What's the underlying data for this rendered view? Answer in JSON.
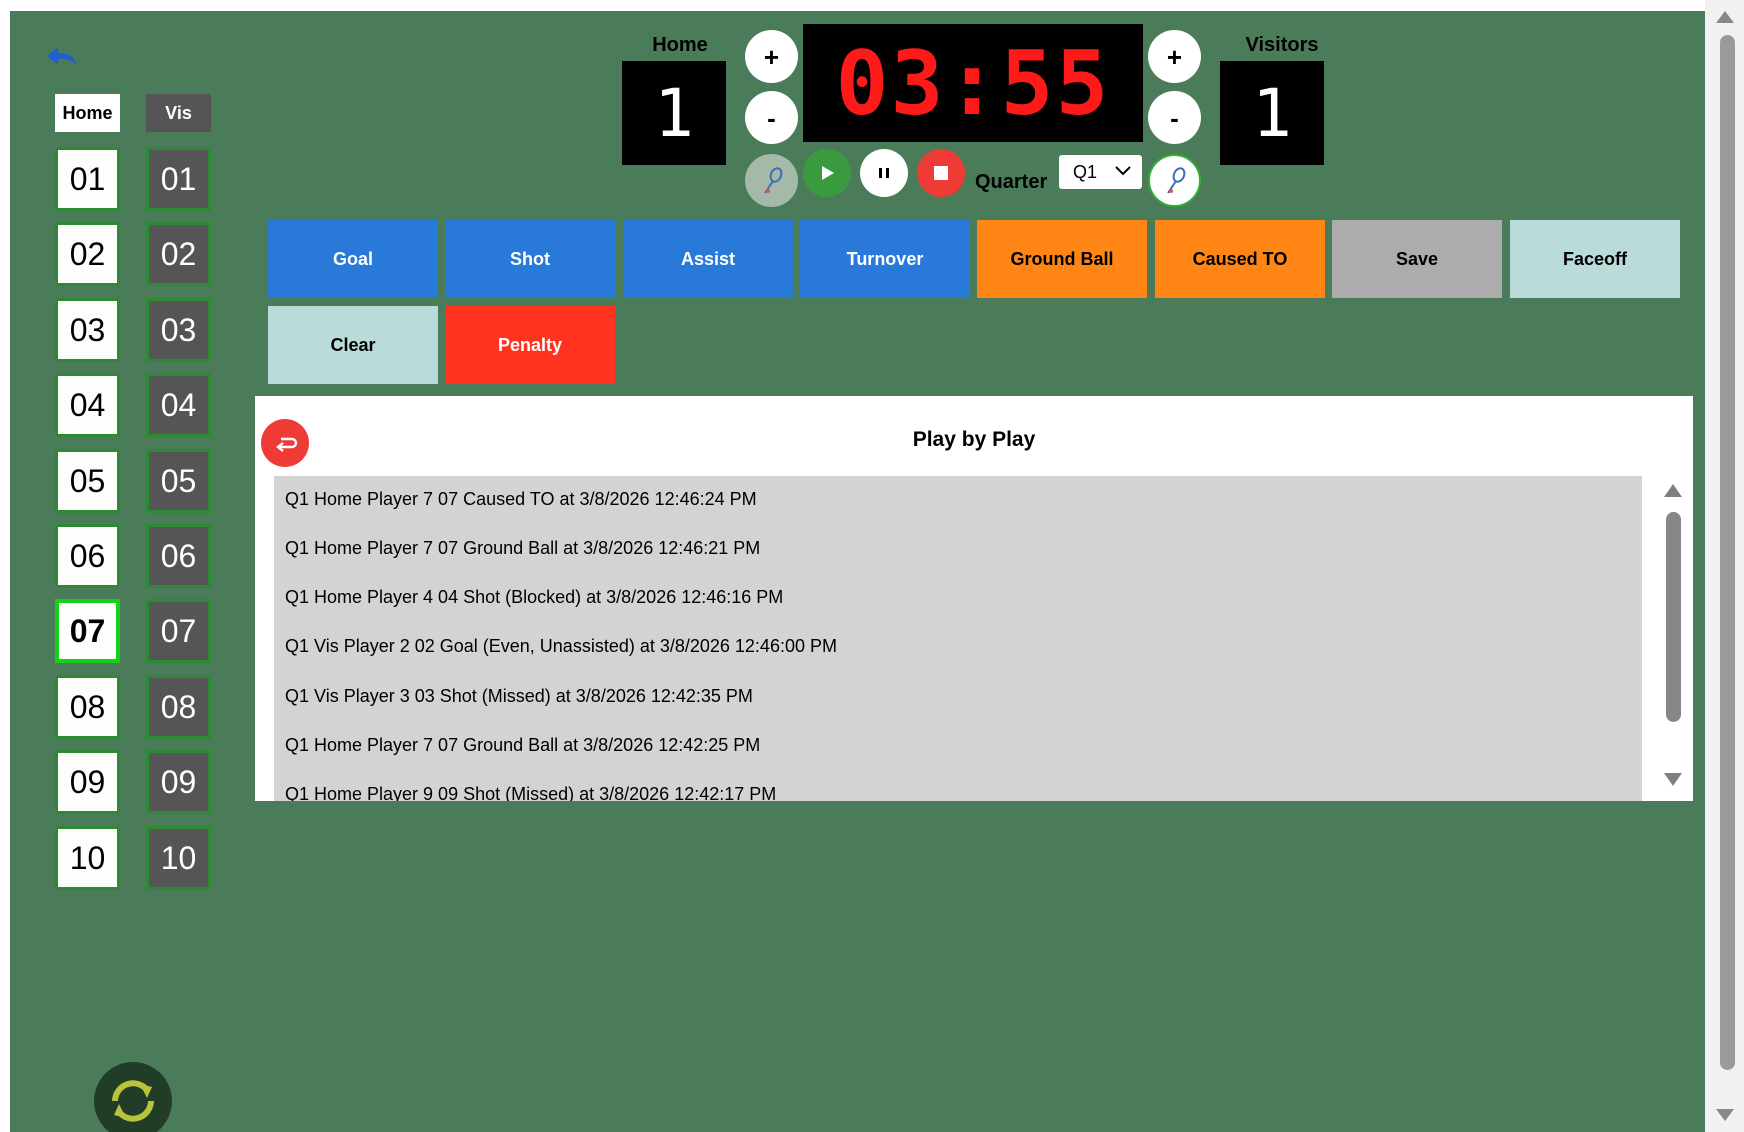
{
  "colors": {
    "background": "#4b7c5a",
    "clock_digits": "#ff1a1a",
    "action_blue": "#2879d8",
    "action_orange": "#ff8514",
    "action_grey": "#acacac",
    "action_light": "#b9dbd9",
    "action_red": "#ff3320",
    "selected_border": "#14d21a"
  },
  "roster": {
    "home_label": "Home",
    "vis_label": "Vis",
    "home_players": [
      "01",
      "02",
      "03",
      "04",
      "05",
      "06",
      "07",
      "08",
      "09",
      "10"
    ],
    "vis_players": [
      "01",
      "02",
      "03",
      "04",
      "05",
      "06",
      "07",
      "08",
      "09",
      "10"
    ],
    "selected_home": "07"
  },
  "scoreboard": {
    "home_label": "Home",
    "home_score": "1",
    "visitors_label": "Visitors",
    "visitors_score": "1",
    "plus": "+",
    "minus": "-",
    "clock": "03:55",
    "quarter_label": "Quarter",
    "quarter_value": "Q1"
  },
  "actions": {
    "goal": "Goal",
    "shot": "Shot",
    "assist": "Assist",
    "turnover": "Turnover",
    "ground_ball": "Ground Ball",
    "caused_to": "Caused TO",
    "save": "Save",
    "faceoff": "Faceoff",
    "clear": "Clear",
    "penalty": "Penalty"
  },
  "play_by_play": {
    "title": "Play by Play",
    "entries": [
      "Q1 Home Player 7 07 Caused TO at 3/8/2026 12:46:24 PM",
      "Q1 Home Player 7 07 Ground Ball at 3/8/2026 12:46:21 PM",
      "Q1 Home Player 4 04 Shot (Blocked) at 3/8/2026 12:46:16 PM",
      "Q1 Vis Player 2 02 Goal (Even, Unassisted) at 3/8/2026 12:46:00 PM",
      "Q1 Vis Player 3 03 Shot (Missed) at 3/8/2026 12:42:35 PM",
      "Q1 Home Player 7 07 Ground Ball at 3/8/2026 12:42:25 PM",
      "Q1 Home Player 9 09 Shot (Missed) at 3/8/2026 12:42:17 PM"
    ]
  },
  "icons": {
    "back": "back-arrow-icon",
    "refresh": "refresh-icon",
    "lacrosse": "lacrosse-stick-icon",
    "play": "play-icon",
    "pause": "pause-icon",
    "stop": "stop-icon",
    "undo": "undo-icon"
  }
}
